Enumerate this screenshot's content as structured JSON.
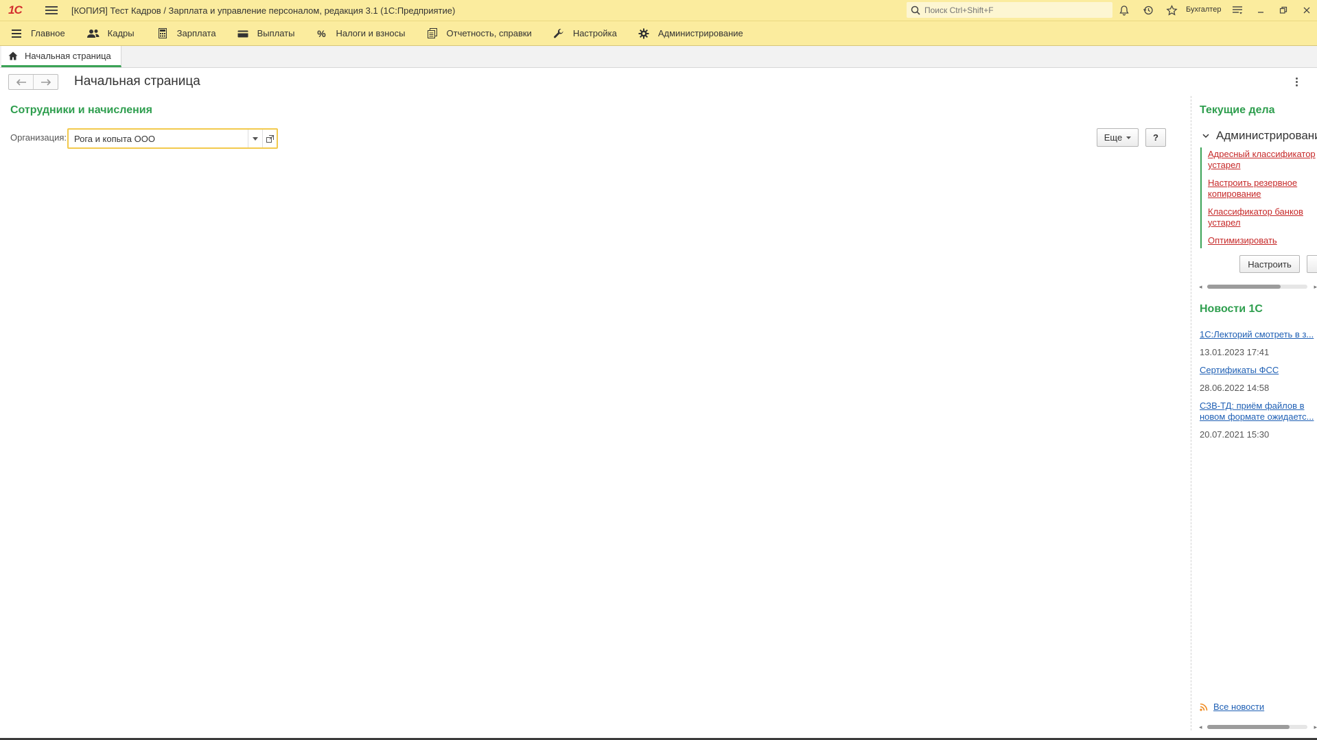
{
  "app": {
    "title": "[КОПИЯ] Тест Кадров / Зарплата и управление персоналом, редакция 3.1  (1С:Предприятие)",
    "logo_text": "1С",
    "search_placeholder": "Поиск Ctrl+Shift+F",
    "user": "Бухгалтер"
  },
  "menu": [
    {
      "label": "Главное",
      "icon": "hamburger-icon"
    },
    {
      "label": "Кадры",
      "icon": "people-icon"
    },
    {
      "label": "Зарплата",
      "icon": "calculator-icon"
    },
    {
      "label": "Выплаты",
      "icon": "wallet-icon"
    },
    {
      "label": "Налоги и взносы",
      "icon": "percent-icon"
    },
    {
      "label": "Отчетность, справки",
      "icon": "documents-icon"
    },
    {
      "label": "Настройка",
      "icon": "wrench-icon"
    },
    {
      "label": "Администрирование",
      "icon": "gear-icon"
    }
  ],
  "tab": {
    "label": "Начальная страница"
  },
  "page": {
    "title": "Начальная страница"
  },
  "main": {
    "section_title": "Сотрудники и начисления",
    "org_label": "Организация:",
    "org_value": "Рога и копыта ООО",
    "more_button": "Еще",
    "help_button": "?"
  },
  "todo": {
    "title": "Текущие дела",
    "group": "Администрирование",
    "items": [
      {
        "line1": "Адресный классификатор",
        "line2": "устарел"
      },
      {
        "line1": "Настроить резервное",
        "line2": "копирование"
      },
      {
        "line1": "Классификатор банков",
        "line2": "устарел"
      },
      {
        "line1": "Оптимизировать",
        "line2": ""
      }
    ],
    "configure_button": "Настроить"
  },
  "news": {
    "title": "Новости 1С",
    "items": [
      {
        "line1": "1С:Лекторий смотреть в з...",
        "line2": "",
        "date": "13.01.2023 17:41"
      },
      {
        "line1": "Сертификаты ФСС",
        "line2": "",
        "date": "28.06.2022 14:58"
      },
      {
        "line1": "СЗВ-ТД: приём файлов в",
        "line2": "новом формате ожидаетс...",
        "date": "20.07.2021 15:30"
      }
    ],
    "all_news": "Все новости"
  },
  "colors": {
    "header_bg": "#fbec9e",
    "accent_green": "#2e9e4e",
    "todo_red": "#c62828",
    "link_blue": "#1e5fb4",
    "focus_yellow": "#f2c94c"
  }
}
